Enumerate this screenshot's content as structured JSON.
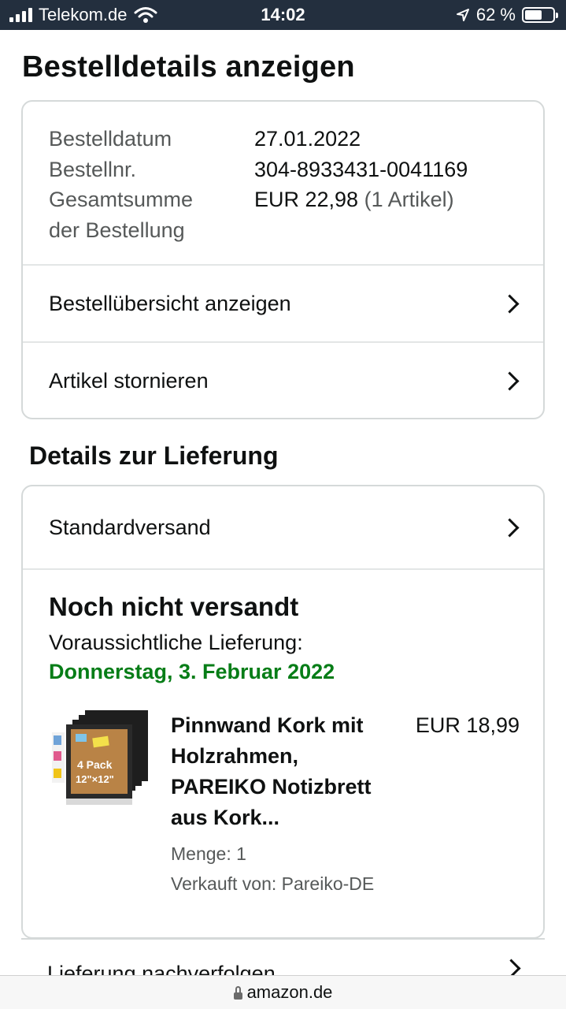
{
  "status_bar": {
    "carrier": "Telekom.de",
    "time": "14:02",
    "battery_percent": "62 %",
    "battery_level": 0.62
  },
  "page": {
    "title": "Bestelldetails anzeigen"
  },
  "order_summary": {
    "date_label": "Bestelldatum",
    "date_value": "27.01.2022",
    "number_label": "Bestellnr.",
    "number_value": "304-8933431-0041169",
    "total_label_line1": "Gesamtsumme",
    "total_label_line2": "der Bestellung",
    "total_value": "EUR 22,98",
    "total_items": "(1 Artikel)"
  },
  "order_actions": [
    {
      "label": "Bestellübersicht anzeigen"
    },
    {
      "label": "Artikel stornieren"
    }
  ],
  "delivery": {
    "section_title": "Details zur Lieferung",
    "shipping_method": "Standardversand",
    "status": "Noch nicht versandt",
    "eta_label": "Voraussichtliche Lieferung:",
    "eta_date": "Donnerstag, 3. Februar 2022",
    "accent_color": "#067d17",
    "item": {
      "title_lines": [
        "Pinnwand Kork mit",
        "Holzrahmen,",
        "PAREIKO Notizbrett",
        "aus Kork..."
      ],
      "price": "EUR 18,99",
      "quantity": "Menge: 1",
      "seller": "Verkauft von: Pareiko-DE",
      "thumb_text_line1": "4 Pack",
      "thumb_text_line2": "12\"×12\""
    },
    "track_label": "Lieferung nachverfolgen"
  },
  "browser": {
    "url": "amazon.de"
  }
}
